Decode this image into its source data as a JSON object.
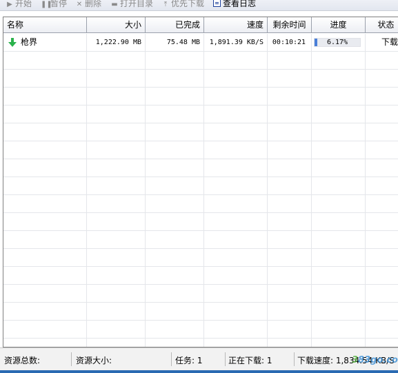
{
  "toolbar": {
    "buttons": [
      {
        "label": "开始",
        "icon": "play-icon",
        "enabled": false
      },
      {
        "label": "暂停",
        "icon": "pause-icon",
        "enabled": false
      },
      {
        "label": "删除",
        "icon": "delete-icon",
        "enabled": false
      },
      {
        "label": "打开目录",
        "icon": "folder-icon",
        "enabled": false
      },
      {
        "label": "优先下载",
        "icon": "priority-icon",
        "enabled": false
      },
      {
        "label": "查看日志",
        "icon": "log-icon",
        "enabled": true
      }
    ]
  },
  "list": {
    "columns": [
      "名称",
      "大小",
      "已完成",
      "速度",
      "剩余时间",
      "进度",
      "状态"
    ],
    "rows": [
      {
        "name": "枪界",
        "size": "1,222.90 MB",
        "completed": "75.48 MB",
        "speed": "1,891.39 KB/S",
        "remaining": "00:10:21",
        "progress_text": "6.17%",
        "progress_value": 0.0617,
        "status": "下载"
      }
    ]
  },
  "statusbar": {
    "total_resources": "资源总数:",
    "resource_size": "资源大小:",
    "tasks": "任务: 1",
    "downloading": "正在下载: 1",
    "download_speed": "下载速度: 1,834.54 KB/S"
  },
  "watermark": {
    "part1": "3",
    "part2": "83go.com"
  },
  "colors": {
    "accent": "#4a7fd8",
    "status_strip": "#2a6ab2",
    "arrow": "#2bb24c"
  }
}
